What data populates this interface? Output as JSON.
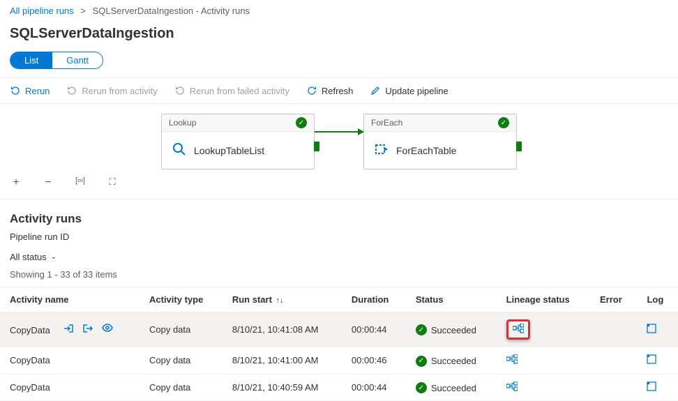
{
  "breadcrumb": {
    "root": "All pipeline runs",
    "current": "SQLServerDataIngestion - Activity runs"
  },
  "page_title": "SQLServerDataIngestion",
  "view_toggle": {
    "list": "List",
    "gantt": "Gantt"
  },
  "toolbar": {
    "rerun": "Rerun",
    "rerun_activity": "Rerun from activity",
    "rerun_failed": "Rerun from failed activity",
    "refresh": "Refresh",
    "update": "Update pipeline"
  },
  "nodes": {
    "lookup": {
      "type": "Lookup",
      "name": "LookupTableList"
    },
    "foreach": {
      "type": "ForEach",
      "name": "ForEachTable"
    }
  },
  "section": {
    "title": "Activity runs",
    "subtitle": "Pipeline run ID"
  },
  "filter": {
    "all_status": "All status"
  },
  "count": "Showing 1 - 33 of 33 items",
  "columns": {
    "activity_name": "Activity name",
    "activity_type": "Activity type",
    "run_start": "Run start",
    "duration": "Duration",
    "status": "Status",
    "lineage": "Lineage status",
    "error": "Error",
    "log": "Log"
  },
  "rows": [
    {
      "name": "CopyData",
      "type": "Copy data",
      "start": "8/10/21, 10:41:08 AM",
      "duration": "00:00:44",
      "status": "Succeeded"
    },
    {
      "name": "CopyData",
      "type": "Copy data",
      "start": "8/10/21, 10:41:00 AM",
      "duration": "00:00:46",
      "status": "Succeeded"
    },
    {
      "name": "CopyData",
      "type": "Copy data",
      "start": "8/10/21, 10:40:59 AM",
      "duration": "00:00:44",
      "status": "Succeeded"
    }
  ]
}
